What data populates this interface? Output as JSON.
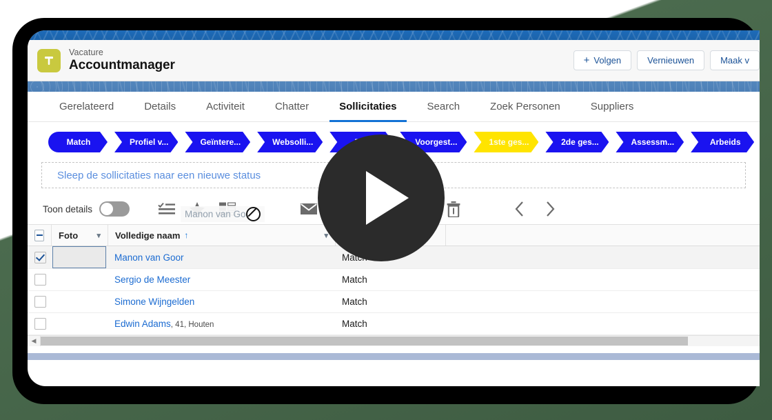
{
  "window": {
    "record": {
      "eyebrow": "Vacature",
      "title": "Accountmanager",
      "icon_letter": "T",
      "icon_name": "vacancy-icon",
      "icon_color": "#c9c93f"
    },
    "actions": [
      {
        "label": "Volgen",
        "icon": "plus-icon",
        "has_plus": true
      },
      {
        "label": "Vernieuwen",
        "has_plus": false
      },
      {
        "label": "Maak v",
        "has_plus": false
      }
    ],
    "tabs": [
      {
        "label": "Gerelateerd",
        "active": false
      },
      {
        "label": "Details",
        "active": false
      },
      {
        "label": "Activiteit",
        "active": false
      },
      {
        "label": "Chatter",
        "active": false
      },
      {
        "label": "Sollicitaties",
        "active": true
      },
      {
        "label": "Search",
        "active": false
      },
      {
        "label": "Zoek Personen",
        "active": false
      },
      {
        "label": "Suppliers",
        "active": false
      }
    ],
    "path": {
      "active_color": "#ffe400",
      "step_color": "#1a13f0",
      "steps": [
        {
          "label": "Match",
          "current": false
        },
        {
          "label": "Profiel v...",
          "current": false
        },
        {
          "label": "Geïntere...",
          "current": false
        },
        {
          "label": "Websolli...",
          "current": false
        },
        {
          "label": "Tel...",
          "current": false
        },
        {
          "label": "Voorgest...",
          "current": false
        },
        {
          "label": "1ste ges...",
          "current": true
        },
        {
          "label": "2de ges...",
          "current": false
        },
        {
          "label": "Assessm...",
          "current": false
        },
        {
          "label": "Arbeids",
          "current": false
        }
      ]
    },
    "dropzone": {
      "text": "Sleep de sollicitaties naar een nieuwe status"
    },
    "drag_ghost": {
      "label": "Manon van Goor",
      "cursor": "no-drop-icon"
    },
    "toolbar": {
      "toggle_label": "Toon details",
      "toggle_on": false,
      "icons": [
        "checklist-icon",
        "star-icon",
        "kanban-board-icon",
        "envelope-icon",
        "chat-bubble-icon",
        "trash-icon",
        "chevron-left-icon",
        "chevron-right-icon"
      ]
    },
    "table": {
      "columns": [
        {
          "key": "select",
          "label": ""
        },
        {
          "key": "foto",
          "label": "Foto"
        },
        {
          "key": "naam",
          "label": "Volledige naam",
          "sorted": "asc",
          "sort_glyph": "↑"
        },
        {
          "key": "status",
          "label": "Status"
        }
      ],
      "rows": [
        {
          "selected": true,
          "naam": "Manon van Goor",
          "meta": "",
          "status": "Match"
        },
        {
          "selected": false,
          "naam": "Sergio de Meester",
          "meta": "",
          "status": "Match"
        },
        {
          "selected": false,
          "naam": "Simone Wijngelden",
          "meta": "",
          "status": "Match"
        },
        {
          "selected": false,
          "naam": "Edwin Adams",
          "meta": ", 41, Houten",
          "status": "Match"
        }
      ]
    }
  },
  "overlay": {
    "play_button": "play-icon"
  }
}
